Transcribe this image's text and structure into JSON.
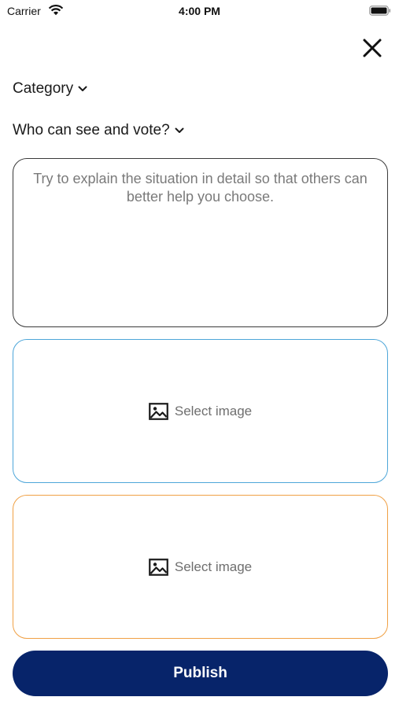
{
  "status_bar": {
    "carrier": "Carrier",
    "time": "4:00 PM",
    "wifi_icon": "wifi-icon",
    "battery_icon": "battery-icon"
  },
  "header": {
    "close_icon": "close-icon"
  },
  "form": {
    "category_label": "Category",
    "visibility_label": "Who can see and vote?",
    "dropdown_icon": "chevron-down-icon",
    "description_value": "",
    "description_placeholder": "Try to explain the situation in detail so that others can better help you choose.",
    "image_options": [
      {
        "label": "Select image",
        "icon": "image-icon",
        "border_color": "#4da6d9"
      },
      {
        "label": "Select image",
        "icon": "image-icon",
        "border_color": "#f0a044"
      }
    ],
    "publish_label": "Publish",
    "publish_color": "#07246a"
  }
}
